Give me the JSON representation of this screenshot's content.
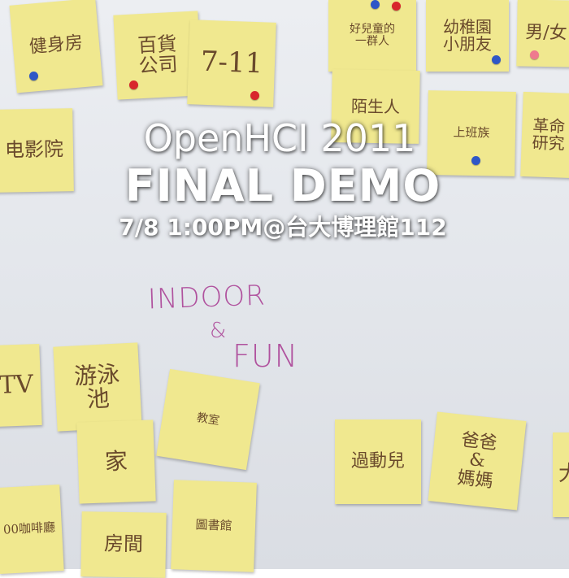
{
  "headline": {
    "line1": "OpenHCI 2011",
    "line2": "FINAL DEMO",
    "line3": "7/8 1:00PM@台大博理館112"
  },
  "board_writing": {
    "indoor": "INDOOR",
    "amp": "&",
    "fun": "FUN"
  },
  "notes": [
    {
      "text": "健身房"
    },
    {
      "text": "百貨\n公司"
    },
    {
      "text": "7-11"
    },
    {
      "text": "好兒童的\n一群人"
    },
    {
      "text": "陌生人"
    },
    {
      "text": "幼稚園\n小朋友"
    },
    {
      "text": "男/女"
    },
    {
      "text": "电影院"
    },
    {
      "text": "上班族"
    },
    {
      "text": "革命\n研究"
    },
    {
      "text": "TV"
    },
    {
      "text": "游泳\n池"
    },
    {
      "text": "教室"
    },
    {
      "text": "家"
    },
    {
      "text": "過動兒"
    },
    {
      "text": "爸爸\n&\n媽媽"
    },
    {
      "text": "大"
    },
    {
      "text": "00咖啡廳"
    },
    {
      "text": "圖書館"
    },
    {
      "text": "房間"
    }
  ],
  "colors": {
    "note": "#f0e88f",
    "pin_red": "#d8262c",
    "pin_blue": "#2f57c7",
    "pin_pink": "#ef7a8e",
    "marker": "#b0529e",
    "headline": "#ffffff"
  }
}
